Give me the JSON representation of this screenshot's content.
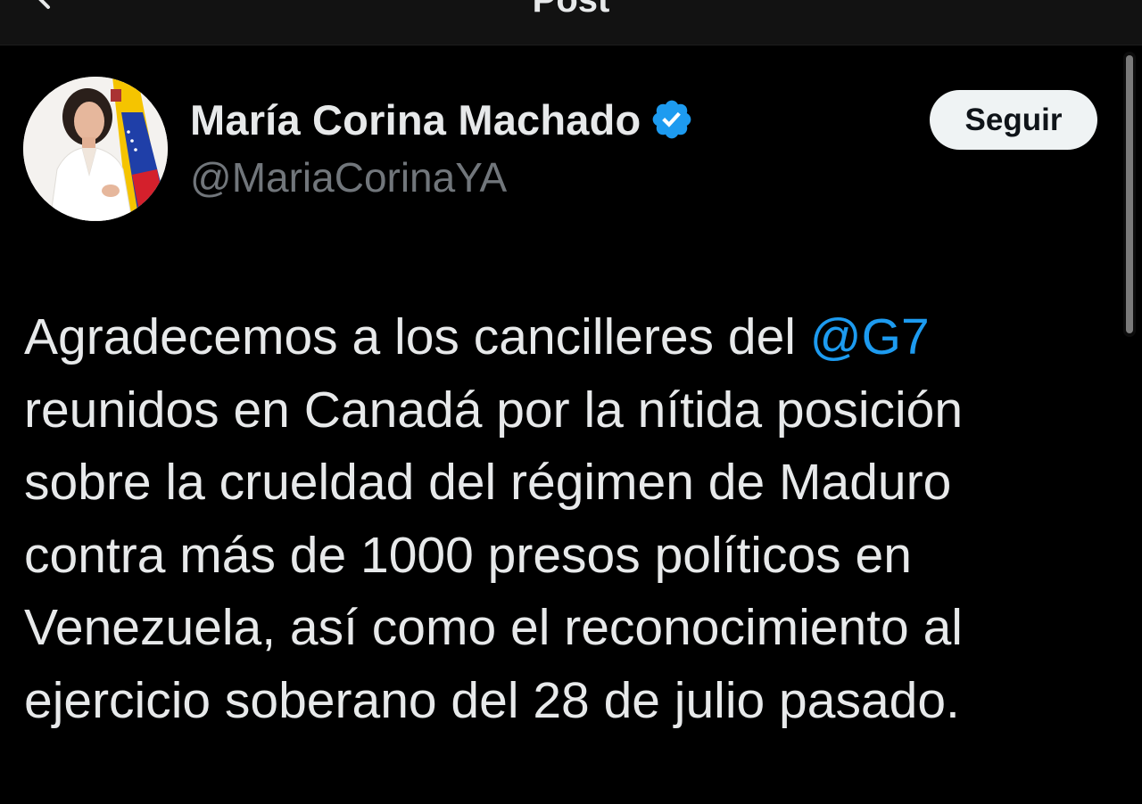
{
  "header": {
    "title": "Post"
  },
  "post": {
    "author": {
      "display_name": "María Corina Machado",
      "handle": "@MariaCorinaYA",
      "verified": true
    },
    "follow_label": "Seguir",
    "text_lines": [
      {
        "before": "Agradecemos a los cancilleres del ",
        "mention": "@G7"
      },
      {
        "before": "reunidos en Canadá por la nítida posición"
      },
      {
        "before": "sobre la crueldad del régimen de Maduro"
      },
      {
        "before": "contra más de 1000 presos políticos en"
      },
      {
        "before": "Venezuela, así como el reconocimiento al"
      },
      {
        "before": "ejercicio soberano del 28 de julio pasado."
      }
    ]
  },
  "colors": {
    "background": "#000000",
    "text": "#e7e9ea",
    "secondary_text": "#71767b",
    "accent": "#1d9bf0",
    "follow_button": "#eff3f4"
  },
  "icons": {
    "back": "back-arrow-icon",
    "verified": "verified-badge-icon"
  }
}
